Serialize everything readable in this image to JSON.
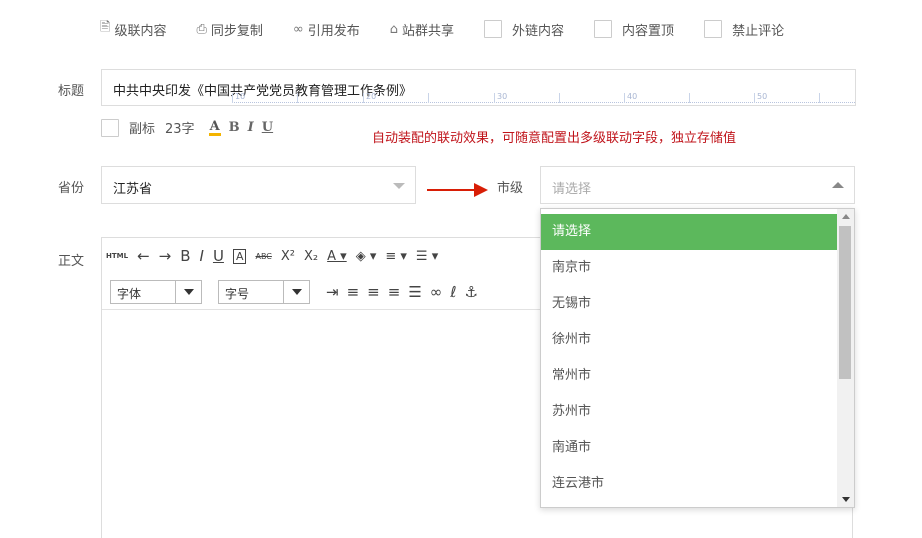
{
  "toolbar": {
    "cascade_label": "级联内容",
    "sync_copy_label": "同步复制",
    "cite_publish_label": "引用发布",
    "site_share_label": "站群共享",
    "external_link_label": "外链内容",
    "pin_top_label": "内容置顶",
    "no_comment_label": "禁止评论"
  },
  "title_field": {
    "label": "标题",
    "value": "中共中央印发《中国共产党党员教育管理工作条例》",
    "ruler_marks": [
      "10",
      "20",
      "30",
      "40",
      "50"
    ]
  },
  "subtitle": {
    "label": "副标",
    "char_count": "23字",
    "format_buttons": [
      "A",
      "B",
      "I",
      "U"
    ]
  },
  "note": "自动装配的联动效果，可随意配置出多级联动字段，独立存储值",
  "province": {
    "label": "省份",
    "value": "江苏省"
  },
  "city": {
    "label": "市级",
    "placeholder": "请选择",
    "options": [
      "请选择",
      "南京市",
      "无锡市",
      "徐州市",
      "常州市",
      "苏州市",
      "南通市",
      "连云港市"
    ]
  },
  "editor": {
    "label": "正文",
    "font_select": "字体",
    "size_select": "字号",
    "html_button": "HTML"
  },
  "colors": {
    "accent_green": "#5cb85c",
    "note_red": "#c0141b",
    "arrow_red": "#d81e06"
  }
}
